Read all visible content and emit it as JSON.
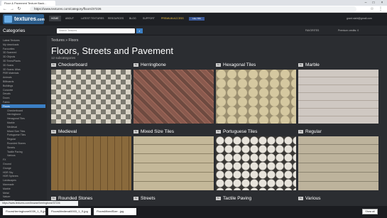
{
  "browser": {
    "tab_title": "Floor & Pavement Texture Back...",
    "url": "https://www.textures.com/category/floors/37226"
  },
  "site": {
    "logo": "textures",
    "logo_suffix": ".com",
    "nav": [
      "HOME",
      "ABOUT",
      "LATEST TEXTURES",
      "RESOURCES",
      "BLOG",
      "SUPPORT",
      "PREMIUM ACCESS"
    ],
    "like": "Like 78K",
    "user": "grant.stahl@gmail.com",
    "search_placeholder": "Search Textures",
    "favorites": "FAVORITES",
    "credits": "Premium credits: 0"
  },
  "sidebar": {
    "title": "Categories",
    "items": [
      "Latest Textures",
      "My downloads",
      "Favourites",
      "3D Scanned",
      "3D Objects",
      "3D Trees/Plants",
      "3D Scans",
      "3D Scans: Atlas",
      "PBR Materials",
      "Animals",
      "Billboards",
      "Buildings",
      "Concrete",
      "Decals",
      "Doors",
      "Fabric",
      "Floors",
      "Checkerboard",
      "Herringbone",
      "Hexagonal Tiles",
      "Marble",
      "Medieval",
      "Mixed Size Tiles",
      "Portuguese Tiles",
      "Regular",
      "Rounded Stones",
      "Streets",
      "Tactile Paving",
      "Various",
      "FX",
      "Ground",
      "Grunge",
      "HDR Sky",
      "HDR Spheres",
      "Landscapes",
      "Manmade",
      "Marble",
      "Metal",
      "Nature",
      "Ornaments"
    ],
    "selected_index": 16
  },
  "main": {
    "breadcrumb_home": "Textures",
    "breadcrumb_sep": "»",
    "breadcrumb_current": "Floors",
    "title": "Floors, Streets and Pavement",
    "subcount": "12 subcategories",
    "tiles": [
      {
        "name": "Checkerboard",
        "badge": "5x"
      },
      {
        "name": "Herringbone",
        "badge": "5x"
      },
      {
        "name": "Hexagonal Tiles",
        "badge": "5x"
      },
      {
        "name": "Marble",
        "badge": "5x"
      },
      {
        "name": "Medieval",
        "badge": "5x"
      },
      {
        "name": "Mixed Size Tiles",
        "badge": "5x"
      },
      {
        "name": "Portuguese Tiles",
        "badge": "5x"
      },
      {
        "name": "Regular",
        "badge": "5x"
      },
      {
        "name": "Rounded Stones",
        "badge": "5x"
      },
      {
        "name": "Streets",
        "badge": "5x"
      },
      {
        "name": "Tactile Paving",
        "badge": "5x"
      },
      {
        "name": "Various",
        "badge": "5x"
      }
    ]
  },
  "status_url": "https://www.textures.com/browse/herringbone/37226",
  "downloads": [
    "FloorsHerringbone0039_1_S.jpg",
    "FloorsMedieval0003_1_S.jpg",
    "FloorsMixedSize...jpg"
  ],
  "show_all": "Show all"
}
